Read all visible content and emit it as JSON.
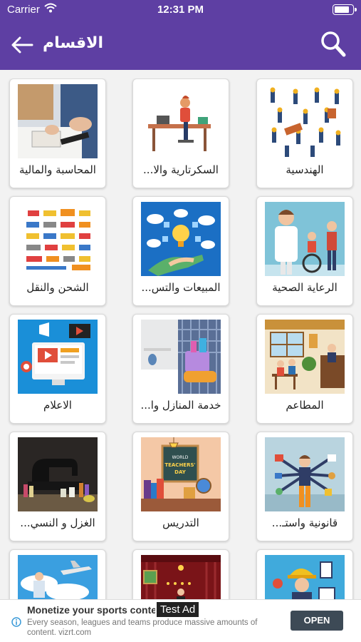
{
  "status_bar": {
    "carrier": "Carrier",
    "time": "12:31 PM"
  },
  "header": {
    "title": "الاقسام"
  },
  "colors": {
    "brand": "#5e3fa3",
    "card_bg": "#ffffff",
    "page_bg": "#f2f2f2",
    "ad_button": "#3d4a56"
  },
  "categories": [
    {
      "label": "المحاسبة والمالية",
      "icon": "accounting-image"
    },
    {
      "label": "السكرتارية والا...",
      "icon": "secretary-image"
    },
    {
      "label": "الهندسية",
      "icon": "engineering-image"
    },
    {
      "label": "الشحن والنقل",
      "icon": "shipping-image"
    },
    {
      "label": "المبيعات والتس...",
      "icon": "sales-image"
    },
    {
      "label": "الرعاية الصحية",
      "icon": "healthcare-image"
    },
    {
      "label": "الاعلام",
      "icon": "media-image"
    },
    {
      "label": "خدمة المنازل وا...",
      "icon": "housekeeping-image"
    },
    {
      "label": "المطاعم",
      "icon": "restaurants-image"
    },
    {
      "label": "الغزل و النسي...",
      "icon": "textile-image"
    },
    {
      "label": "التدريس",
      "icon": "teaching-image"
    },
    {
      "label": "قانونية واستـ...",
      "icon": "legal-image"
    },
    {
      "label": "",
      "icon": "aviation-image"
    },
    {
      "label": "",
      "icon": "entertainment-image"
    },
    {
      "label": "",
      "icon": "construction-image"
    }
  ],
  "ad": {
    "title": "Monetize your sports content",
    "tag": "Test Ad",
    "description": "Every season, leagues and teams produce massive amounts of content. vizrt.com",
    "button": "OPEN"
  }
}
